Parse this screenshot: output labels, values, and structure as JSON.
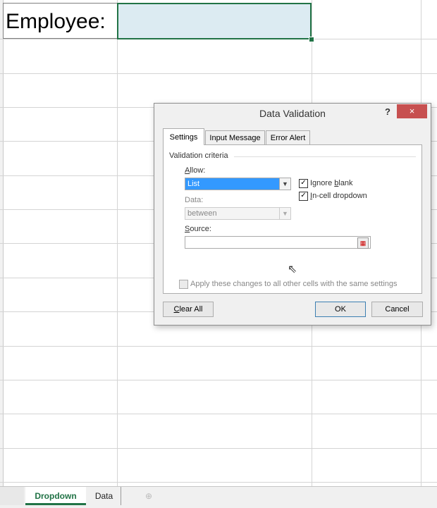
{
  "sheet": {
    "a1_value": "Employee:",
    "b1_value": "",
    "tabs": [
      {
        "label": "Dropdown",
        "active": true
      },
      {
        "label": "Data",
        "active": false
      }
    ],
    "add_sheet_icon": "plus-circle-icon",
    "accent_color": "#217346",
    "selection_fill": "#dcebf2"
  },
  "dialog": {
    "title": "Data Validation",
    "help_label": "?",
    "close_label": "×",
    "tabs": [
      "Settings",
      "Input Message",
      "Error Alert"
    ],
    "active_tab": "Settings",
    "group_label": "Validation criteria",
    "allow_label_prefix": "A",
    "allow_label_rest": "llow:",
    "allow_value": "List",
    "data_label": "Data:",
    "data_value": "between",
    "ignore_blank_pre": "Ignore ",
    "ignore_blank_key": "b",
    "ignore_blank_post": "lank",
    "ignore_blank_checked": true,
    "in_cell_key": "I",
    "in_cell_rest": "n-cell dropdown",
    "in_cell_checked": true,
    "source_key": "S",
    "source_rest": "ource:",
    "source_value": "",
    "apply_all_label": "Apply these changes to all other cells with the same settings",
    "apply_all_checked": false,
    "clear_all_key": "C",
    "clear_all_rest": "lear All",
    "ok_label": "OK",
    "cancel_label": "Cancel",
    "close_color": "#c75050",
    "highlight_color": "#3399ff"
  }
}
